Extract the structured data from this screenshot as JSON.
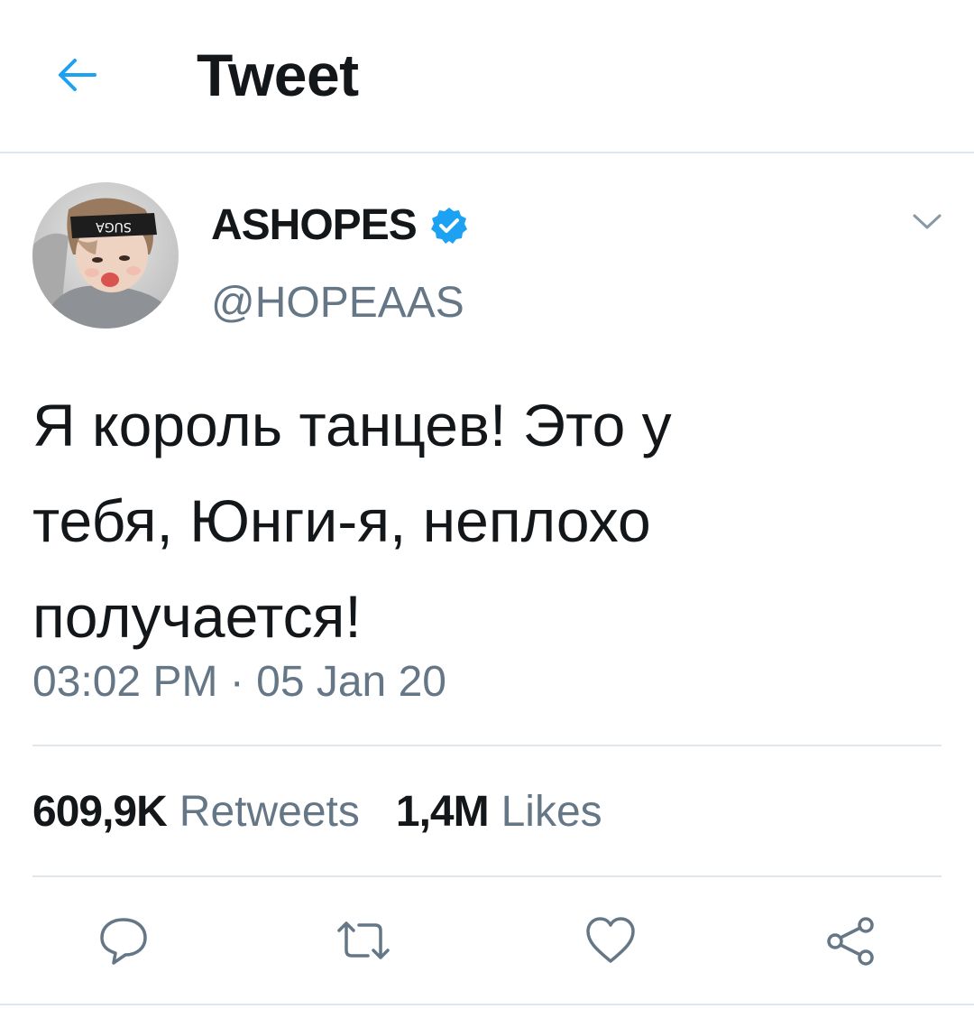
{
  "header": {
    "title": "Tweet",
    "back_icon": "arrow-left-icon",
    "accent_color": "#1da1f2"
  },
  "tweet": {
    "author": {
      "display_name": "ASHOPES",
      "handle": "@HOPEAAS",
      "verified": true,
      "verified_color": "#1da1f2"
    },
    "text_lines": [
      "Я король танцев! Это у",
      "тебя, Юнги-я, неплохо",
      "получается!"
    ],
    "time": "03:02 PM",
    "separator": "·",
    "date": "05 Jan 20",
    "stats": {
      "retweets_count": "609,9K",
      "retweets_label": "Retweets",
      "likes_count": "1,4M",
      "likes_label": "Likes"
    },
    "actions": [
      {
        "icon": "reply-icon"
      },
      {
        "icon": "retweet-icon"
      },
      {
        "icon": "like-icon"
      },
      {
        "icon": "share-icon"
      }
    ]
  },
  "colors": {
    "text_primary": "#14171a",
    "text_secondary": "#657786",
    "divider": "#e1e8ed"
  }
}
